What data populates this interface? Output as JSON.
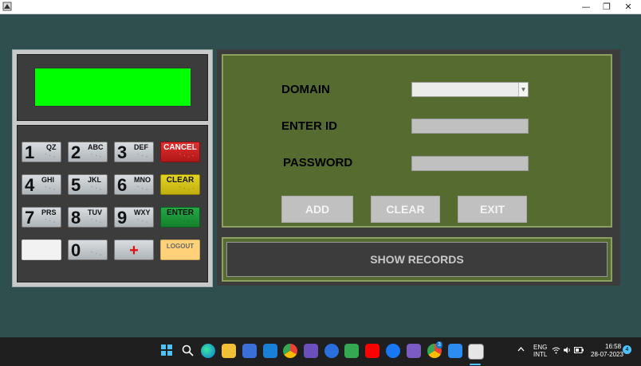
{
  "window": {
    "controls": {
      "minimize": "—",
      "maximize": "❐",
      "close": "✕"
    }
  },
  "keypad": {
    "keys": [
      {
        "digit": "1",
        "letters": "QZ"
      },
      {
        "digit": "2",
        "letters": "ABC"
      },
      {
        "digit": "3",
        "letters": "DEF"
      },
      {
        "digit": "4",
        "letters": "GHI"
      },
      {
        "digit": "5",
        "letters": "JKL"
      },
      {
        "digit": "6",
        "letters": "MNO"
      },
      {
        "digit": "7",
        "letters": "PRS"
      },
      {
        "digit": "8",
        "letters": "TUV"
      },
      {
        "digit": "9",
        "letters": "WXY"
      },
      {
        "digit": "0",
        "letters": ""
      }
    ],
    "cancel_label": "CANCEL",
    "clear_label": "CLEAR",
    "enter_label": "ENTER",
    "logout_label": "LOGOUT",
    "plus_label": "+"
  },
  "form": {
    "domain_label": "DOMAIN",
    "id_label": "ENTER ID",
    "password_label": "PASSWORD",
    "domain_value": "",
    "id_value": "",
    "password_value": "",
    "add_label": "ADD",
    "clear_label": "CLEAR",
    "exit_label": "EXIT",
    "show_records_label": "SHOW RECORDS"
  },
  "taskbar": {
    "language": "ENG",
    "layout": "INTL",
    "time": "16:58",
    "date": "28-07-2023",
    "notification_count": "4",
    "chrome_badge": "3"
  },
  "colors": {
    "background": "#2f4f4f",
    "display": "#00ff00",
    "form_panel": "#556b2f",
    "cancel": "#d02020",
    "clear": "#d8c818",
    "enter": "#1c9a3a",
    "logout": "#ffd27a"
  }
}
